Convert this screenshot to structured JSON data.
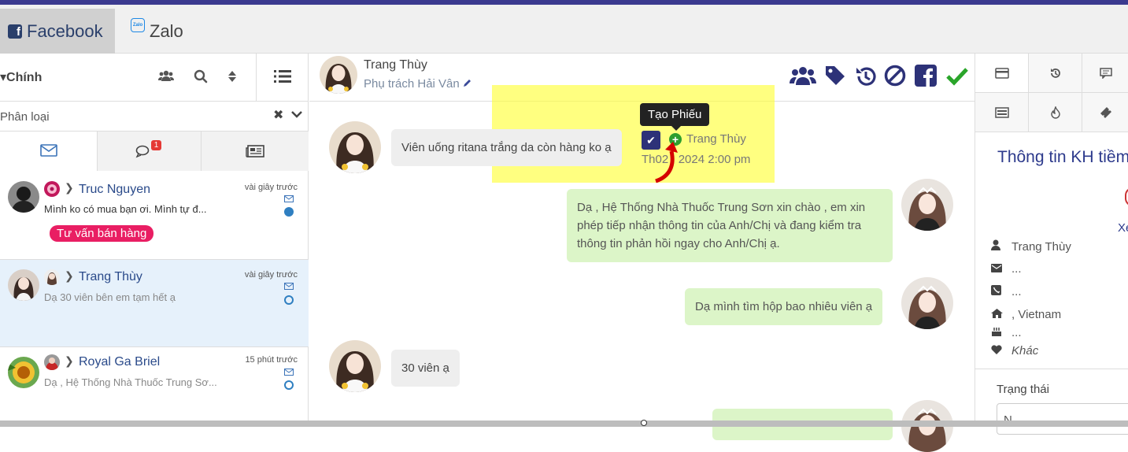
{
  "tabs": {
    "facebook": "Facebook",
    "zalo": "Zalo",
    "zalo_logo": "Zalo"
  },
  "left": {
    "title": "Chính",
    "filter_placeholder": "Phân loại",
    "unread_badge": "1",
    "conversations": [
      {
        "name": "Truc Nguyen",
        "preview": "Mình ko có mua bạn ơi. Mình tự đ...",
        "time": "vài giây trước",
        "tag": "Tư vấn bán hàng",
        "status": "filled"
      },
      {
        "name": "Trang Thùy",
        "preview": "Dạ 30 viên bên em tạm hết ạ",
        "time": "vài giây trước",
        "status": "outline"
      },
      {
        "name": "Royal Ga Briel",
        "preview": "Dạ , Hệ Thống Nhà Thuốc Trung Sơ...",
        "time": "15 phút trước",
        "status": "outline"
      }
    ]
  },
  "chat": {
    "contact_name": "Trang Thùy",
    "assignee": "Phụ trách Hải Vân",
    "tooltip": "Tạo Phiếu",
    "meta_name": "Trang Thùy",
    "meta_time": "Th02 , 2024 2:00 pm",
    "messages": [
      {
        "dir": "in",
        "text": "Viên uống ritana trắng da còn hàng ko ạ"
      },
      {
        "dir": "out",
        "text": "Dạ , Hệ Thống Nhà Thuốc Trung Sơn xin chào , em xin phép tiếp nhận thông tin của Anh/Chị và đang kiểm tra thông tin phản hồi ngay cho Anh/Chị ạ."
      },
      {
        "dir": "out",
        "text": "Dạ mình tìm hộp bao nhiêu viên ạ"
      },
      {
        "dir": "in",
        "text": "30 viên ạ"
      }
    ]
  },
  "right": {
    "title": "Thông tin KH tiềm",
    "view_more": "Xe",
    "name": "Trang Thùy",
    "email": "...",
    "phone": "...",
    "address": ", Vietnam",
    "birthday": "...",
    "gender": "Khác",
    "status_label": "Trạng thái",
    "status_value": "N"
  },
  "colors": {
    "accent": "#2d3278",
    "tag": "#e91e63",
    "outgoing": "#dcf5c8",
    "highlight": "#ffff3c"
  }
}
